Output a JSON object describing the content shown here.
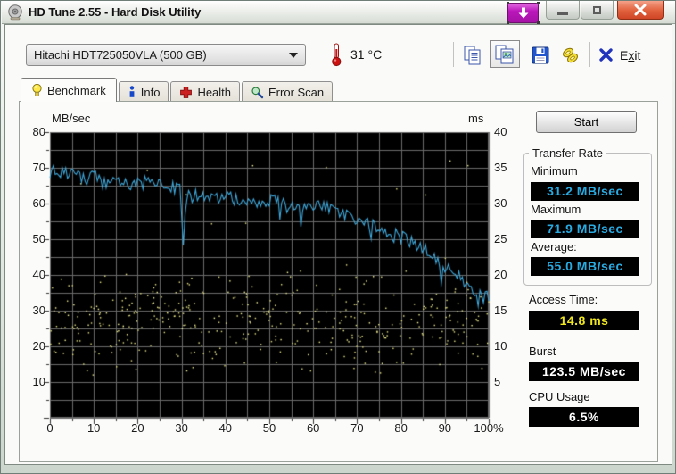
{
  "window": {
    "title": "HD Tune 2.55 - Hard Disk Utility"
  },
  "titlebar": {
    "icons": [
      "hard-disk-app-icon",
      "download-arrow-capture-icon",
      "minimize-icon",
      "maximize-icon",
      "close-icon"
    ],
    "capture_color": "#bb17bb",
    "close_color": "#d8542f"
  },
  "toolbar": {
    "drive_selector": {
      "value": "Hitachi HDT725050VLA (500 GB)"
    },
    "temperature": "31",
    "temperature_unit": "°C",
    "icons": [
      "thermometer-icon",
      "copy-icon",
      "copy-screenshot-icon",
      "save-icon",
      "options-icon",
      "exit-x-icon"
    ],
    "exit_prefix": "E",
    "exit_accel": "x",
    "exit_suffix": "it"
  },
  "tabs": [
    {
      "label": "Benchmark",
      "icon": "lightbulb-icon",
      "active": true
    },
    {
      "label": "Info",
      "icon": "info-icon",
      "active": false
    },
    {
      "label": "Health",
      "icon": "red-cross-icon",
      "active": false
    },
    {
      "label": "Error Scan",
      "icon": "magnifier-icon",
      "active": false
    }
  ],
  "results": {
    "start_label": "Start",
    "transfer_rate": {
      "group_label": "Transfer Rate",
      "minimum_label": "Minimum",
      "minimum": "31.2 MB/sec",
      "maximum_label": "Maximum",
      "maximum": "71.9 MB/sec",
      "average_label": "Average:",
      "average": "55.0 MB/sec"
    },
    "access_time_label": "Access Time:",
    "access_time": "14.8 ms",
    "burst_label": "Burst",
    "burst": "123.5 MB/sec",
    "cpu_label": "CPU Usage",
    "cpu_usage": "6.5%"
  },
  "chart_data": {
    "type": "line",
    "title": "HD Tune read benchmark: transfer rate line with access-time scatter dots",
    "x_axis": {
      "unit": "%",
      "min": 0,
      "max": 100,
      "tick_labels": [
        "0",
        "10",
        "20",
        "30",
        "40",
        "50",
        "60",
        "70",
        "80",
        "90",
        "100%"
      ],
      "minor_step": 5,
      "grid": true
    },
    "y_left_axis": {
      "label": "MB/sec",
      "min": 0,
      "max": 80,
      "tick_labels": [
        "80",
        "70",
        "60",
        "50",
        "40",
        "30",
        "20",
        "10"
      ],
      "grid_step": 5
    },
    "y_right_axis": {
      "label": "ms",
      "min": 0,
      "max": 40,
      "tick_labels": [
        "40",
        "35",
        "30",
        "25",
        "20",
        "15",
        "10",
        "5"
      ]
    },
    "colors": {
      "plot_bg": "#000000",
      "grid": "#6b6b6b",
      "transfer_line": "#3fa9dc",
      "access_dots": "#e9e687",
      "access_dots_bright": "#fdfba0",
      "tick": "#333333"
    },
    "transfer_rate_trend": [
      [
        0,
        70
      ],
      [
        2,
        69
      ],
      [
        4,
        68.8
      ],
      [
        6,
        67.5
      ],
      [
        8,
        66.5
      ],
      [
        10,
        67.5
      ],
      [
        12,
        66
      ],
      [
        14,
        66.5
      ],
      [
        16,
        65.5
      ],
      [
        18,
        65.8
      ],
      [
        20,
        65.5
      ],
      [
        22,
        66
      ],
      [
        24,
        65.5
      ],
      [
        26,
        65.8
      ],
      [
        28,
        64.5
      ],
      [
        30,
        63.5
      ],
      [
        32,
        62
      ],
      [
        34,
        62.5
      ],
      [
        36,
        61.5
      ],
      [
        38,
        61
      ],
      [
        40,
        61.8
      ],
      [
        42,
        61
      ],
      [
        44,
        61.3
      ],
      [
        46,
        60.8
      ],
      [
        48,
        60.3
      ],
      [
        50,
        61.5
      ],
      [
        52,
        60
      ],
      [
        54,
        59.3
      ],
      [
        56,
        60
      ],
      [
        58,
        59.8
      ],
      [
        60,
        60
      ],
      [
        62,
        59.3
      ],
      [
        64,
        58.5
      ],
      [
        66,
        57.3
      ],
      [
        68,
        56
      ],
      [
        70,
        55.5
      ],
      [
        72,
        54.5
      ],
      [
        74,
        53.5
      ],
      [
        76,
        52.5
      ],
      [
        78,
        51.5
      ],
      [
        80,
        50.5
      ],
      [
        82,
        49.5
      ],
      [
        84,
        48
      ],
      [
        86,
        46.5
      ],
      [
        88,
        45
      ],
      [
        90,
        42.5
      ],
      [
        92,
        40.5
      ],
      [
        94,
        38.5
      ],
      [
        96,
        36.5
      ],
      [
        97,
        34.5
      ],
      [
        98,
        35
      ],
      [
        99,
        33.5
      ],
      [
        100,
        34.5
      ]
    ],
    "dip_spikes": [
      [
        30.4,
        48.3
      ],
      [
        57,
        53.5
      ],
      [
        89,
        37.5
      ],
      [
        97.5,
        31.2
      ]
    ],
    "jitter": {
      "amplitude": 1.9,
      "seed": 91,
      "step_pct": 0.4
    },
    "access_time_scatter": {
      "count": 430,
      "seed": 17,
      "ms_min": 5.5,
      "ms_peak_high": 19,
      "outlier_fraction": 0.05,
      "ms_outlier_max": 36
    },
    "value_range_clamp": [
      31.2,
      71.9
    ]
  }
}
